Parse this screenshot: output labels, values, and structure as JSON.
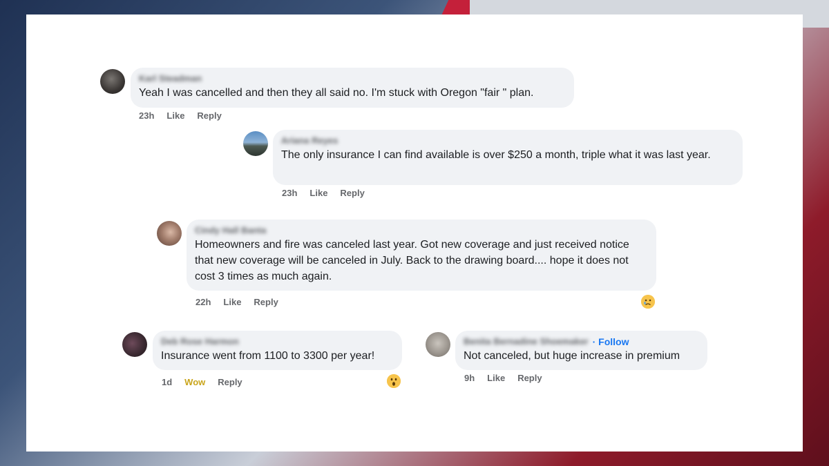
{
  "comments": [
    {
      "author": "Karl Steadman",
      "text": "Yeah I was cancelled and then they all said no. I'm stuck with Oregon \"fair \" plan.",
      "time": "23h",
      "like": "Like",
      "reply": "Reply"
    },
    {
      "author": "Ariana Reyes",
      "text": "The only insurance I can find available is over $250 a month, triple what it was last year.",
      "time": "23h",
      "like": "Like",
      "reply": "Reply"
    },
    {
      "author": "Cindy Hall Banta",
      "text": "Homeowners and fire was canceled last year. Got new coverage and just received notice that new coverage will be canceled in July. Back to the drawing board.... hope it does not cost 3 times as much again.",
      "time": "22h",
      "like": "Like",
      "reply": "Reply",
      "reaction_icon": "sad-reaction-icon"
    },
    {
      "author": "Deb Rose Harmon",
      "text": "Insurance went from 1100 to 3300 per year!",
      "time": "1d",
      "like": "Wow",
      "reply": "Reply",
      "reaction_icon": "wow-reaction-icon"
    },
    {
      "author": "Benita Bernadine Shoemaker",
      "follow": "· Follow",
      "text": "Not canceled, but huge increase in premium",
      "time": "9h",
      "like": "Like",
      "reply": "Reply"
    }
  ],
  "colors": {
    "bubble": "#f0f2f5",
    "meta": "#65676b",
    "follow": "#1877f2",
    "wow": "#c9a51b"
  }
}
